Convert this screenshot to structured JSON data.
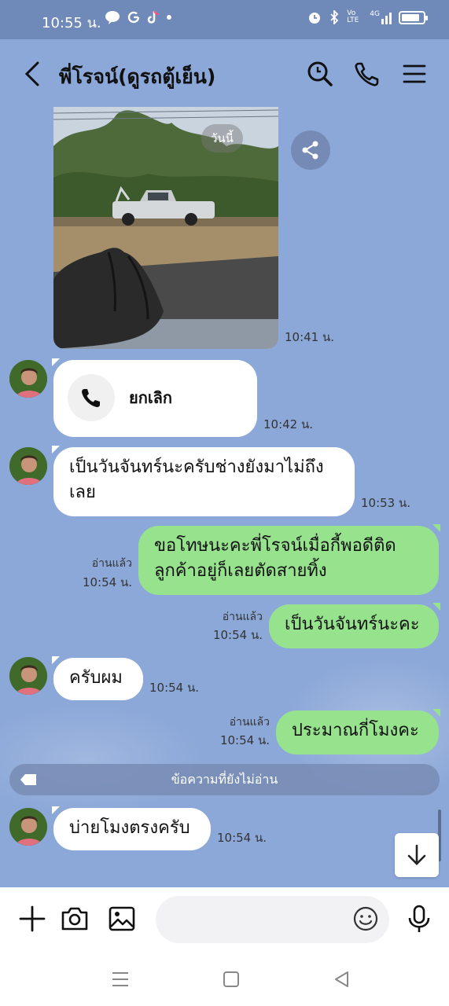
{
  "status_bar": {
    "time": "10:55 น.",
    "icons": [
      "line-icon",
      "google-icon",
      "tiktok-icon",
      "dot-icon",
      "alarm-icon",
      "bluetooth-icon",
      "volte-icon",
      "signal-icon",
      "battery-icon"
    ],
    "volte": "Vo LTE",
    "network": "4G"
  },
  "header": {
    "contact_name": "พี่โรจน์(ดูรถตู้เย็น)"
  },
  "date_pill": "วันนี้",
  "messages": [
    {
      "id": "m1",
      "type": "image",
      "direction": "in",
      "time": "10:41 น."
    },
    {
      "id": "m2",
      "type": "call",
      "direction": "in",
      "text": "ยกเลิก",
      "time": "10:42 น."
    },
    {
      "id": "m3",
      "type": "text",
      "direction": "in",
      "lines": [
        "เป็นวันจันทร์นะครับช่างยังมาไม่ถึง",
        "เลย"
      ],
      "time": "10:53 น."
    },
    {
      "id": "m4",
      "type": "text",
      "direction": "out",
      "lines": [
        "ขอโทษนะคะพี่โรจน์เมื่อกี้พอดีติด",
        "ลูกค้าอยู่ก็เลยตัดสายทิ้ง"
      ],
      "read": "อ่านแล้ว",
      "time": "10:54 น."
    },
    {
      "id": "m5",
      "type": "text",
      "direction": "out",
      "text": "เป็นวันจันทร์นะคะ",
      "read": "อ่านแล้ว",
      "time": "10:54 น."
    },
    {
      "id": "m6",
      "type": "text",
      "direction": "in",
      "text": "ครับผม",
      "time": "10:54 น."
    },
    {
      "id": "m7",
      "type": "text",
      "direction": "out",
      "text": "ประมาณกี่โมงคะ",
      "read": "อ่านแล้ว",
      "time": "10:54 น."
    },
    {
      "id": "m8",
      "type": "text",
      "direction": "in",
      "text": "บ่ายโมงตรงครับ",
      "time": "10:54 น."
    }
  ],
  "unread_divider": "ข้อความที่ยังไม่อ่าน",
  "input": {
    "placeholder": ""
  },
  "colors": {
    "chat_bg": "#8ca8d8",
    "status_bg": "#6f89b8",
    "outgoing_bubble": "#96e28d",
    "incoming_bubble": "#ffffff"
  }
}
